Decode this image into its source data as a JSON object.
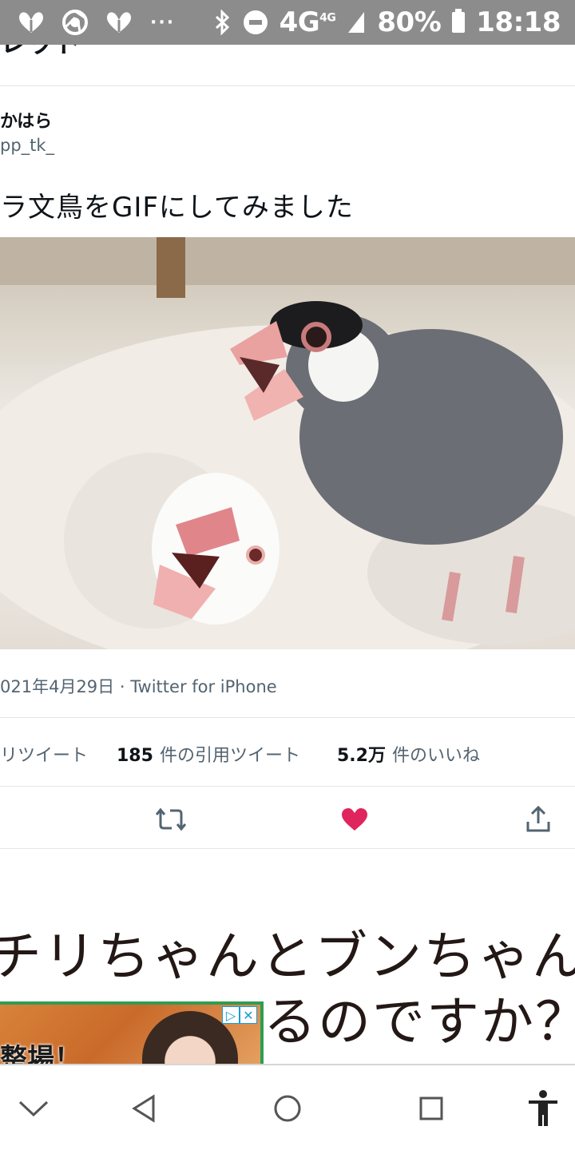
{
  "status_bar": {
    "network": "4G",
    "network_small": "4G",
    "battery": "80%",
    "time": "18:18",
    "overflow": "···"
  },
  "tweet": {
    "thread_title": "レッド",
    "author_name": "かはら",
    "author_handle": "pp_tk_",
    "text": "ラ文鳥をGIFにしてみました",
    "date_source": "021年4月29日 · Twitter for iPhone",
    "stats": {
      "retweets_label": "リツイート",
      "quotes_count": "185",
      "quotes_label": "件の引用ツイート",
      "likes_count": "5.2万",
      "likes_label": "件のいいね"
    },
    "actions": {
      "retweet_icon": "retweet-icon",
      "like_icon": "heart-icon",
      "like_color": "#e0245e",
      "share_icon": "share-icon"
    }
  },
  "article": {
    "heading_line1": "チリちゃんとブンちゃん",
    "heading_line2": "るのですか？"
  },
  "ad": {
    "text": "整場！",
    "choices_icon": "ad-choices-icon",
    "close_icon": "close-icon",
    "close_label": "✕",
    "choices_label": "▷"
  },
  "nav_bar": {
    "icons": [
      "chevron-down-icon",
      "back-icon",
      "home-icon",
      "recents-icon",
      "accessibility-icon"
    ]
  },
  "colors": {
    "status_bar_bg": "#8c8c8c",
    "text_primary": "#0f1419",
    "text_secondary": "#536471",
    "accent_like": "#e0245e",
    "ad_border": "#2e9e52"
  }
}
